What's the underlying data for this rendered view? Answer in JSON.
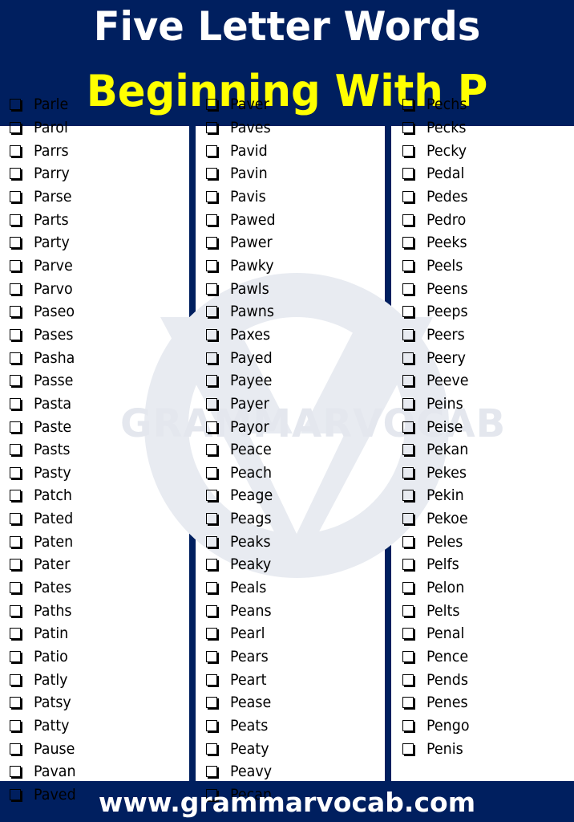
{
  "header": {
    "title_line1": "Five Letter Words",
    "title_line2": "Beginning With P"
  },
  "footer": {
    "url": "www.grammarvocab.com"
  },
  "watermark": {
    "text": "GRAMMARVOCAB"
  },
  "colors": {
    "brand_navy": "#001f5f",
    "title_white": "#ffffff",
    "title_yellow": "#ffff00"
  },
  "icons": {
    "checkbox": "checkbox-icon"
  },
  "columns": [
    [
      "Parle",
      "Parol",
      "Parrs",
      "Parry",
      "Parse",
      "Parts",
      "Party",
      "Parve",
      "Parvo",
      "Paseo",
      "Pases",
      "Pasha",
      "Passe",
      "Pasta",
      "Paste",
      "Pasts",
      "Pasty",
      "Patch",
      "Pated",
      "Paten",
      "Pater",
      "Pates",
      "Paths",
      "Patin",
      "Patio",
      "Patly",
      "Patsy",
      "Patty",
      "Pause",
      "Pavan",
      "Paved"
    ],
    [
      "Paver",
      "Paves",
      "Pavid",
      "Pavin",
      "Pavis",
      "Pawed",
      "Pawer",
      "Pawky",
      "Pawls",
      "Pawns",
      "Paxes",
      "Payed",
      "Payee",
      "Payer",
      "Payor",
      "Peace",
      "Peach",
      "Peage",
      "Peags",
      "Peaks",
      "Peaky",
      "Peals",
      "Peans",
      "Pearl",
      "Pears",
      "Peart",
      "Pease",
      "Peats",
      "Peaty",
      "Peavy",
      "Pecan"
    ],
    [
      "Pechs",
      "Pecks",
      "Pecky",
      "Pedal",
      "Pedes",
      "Pedro",
      "Peeks",
      "Peels",
      "Peens",
      "Peeps",
      "Peers",
      "Peery",
      "Peeve",
      "Peins",
      "Peise",
      "Pekan",
      "Pekes",
      "Pekin",
      "Pekoe",
      "Peles",
      "Pelfs",
      "Pelon",
      "Pelts",
      "Penal",
      "Pence",
      "Pends",
      "Penes",
      "Pengo",
      "Penis"
    ]
  ]
}
